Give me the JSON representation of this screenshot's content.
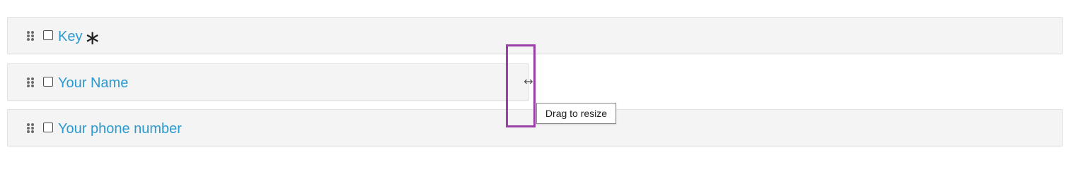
{
  "fields": [
    {
      "label": "Key",
      "required_symbol": "∗"
    },
    {
      "label": "Your Name"
    },
    {
      "label": "Your phone number"
    }
  ],
  "resize": {
    "handle_glyph": "↔",
    "tooltip": "Drag to resize"
  },
  "colors": {
    "label": "#2b9ad0",
    "row_background": "#f4f4f4",
    "highlight": "#9b3fa8"
  },
  "icons": {
    "drag": "drag-handle-icon",
    "resize": "resize-horizontal-icon"
  }
}
